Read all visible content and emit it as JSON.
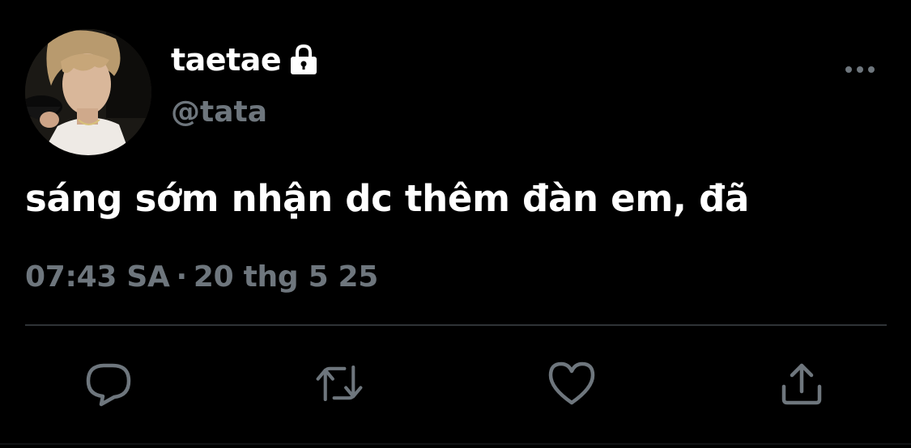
{
  "author": {
    "display_name": "taetae",
    "handle": "@tata",
    "protected": true,
    "avatar_icon": "profile-photo"
  },
  "tweet": {
    "text": "sáng sớm nhận dc thêm đàn em, đã",
    "time": "07:43 SA",
    "separator": "·",
    "date": "20 thg 5 25"
  },
  "actions": [
    {
      "name": "reply",
      "icon": "reply-icon"
    },
    {
      "name": "retweet",
      "icon": "retweet-icon"
    },
    {
      "name": "like",
      "icon": "heart-icon"
    },
    {
      "name": "share",
      "icon": "share-icon"
    }
  ],
  "colors": {
    "background": "#000000",
    "text_primary": "#ffffff",
    "text_secondary": "#6e767d",
    "divider": "#2f3336"
  }
}
